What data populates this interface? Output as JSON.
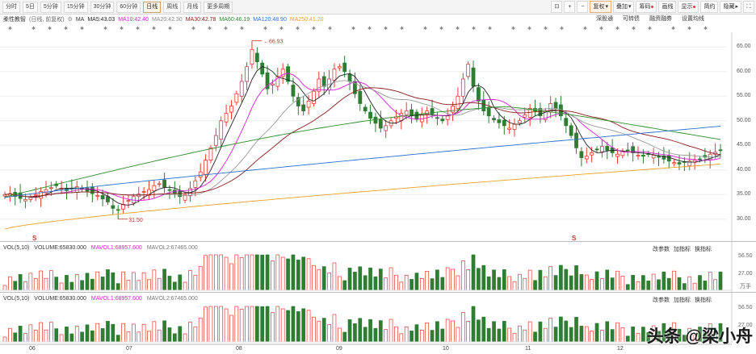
{
  "toolbar": {
    "periods": [
      "分时",
      "5日",
      "5分钟",
      "15分钟",
      "30分钟",
      "60分钟",
      "日线",
      "周线",
      "月线",
      "更多周期"
    ],
    "active_period": "日线",
    "right_buttons": [
      {
        "label": "复权",
        "icon": "chevron-down"
      },
      {
        "label": "叠加",
        "icon": "chevron-down"
      },
      {
        "label": "筹码",
        "badge": true
      },
      {
        "label": "画线"
      },
      {
        "label": "显示",
        "badge": true
      },
      {
        "label": "简约"
      },
      {
        "label": "隐藏",
        "icon": "chevron-right"
      }
    ],
    "small_icons": [
      "⊡",
      "+",
      "−"
    ]
  },
  "ma_line": {
    "title": "柔性教智",
    "sub": "(日线, 前复权)",
    "ma_label": "MA",
    "ma5": "MA5:43.03",
    "ma10": "MA10:42.40",
    "ma20": "MA20:42.30",
    "ma30": "MA30:42.78",
    "ma60": "MA60:46.19",
    "ma120": "MA120:48.90",
    "ma250": "MA250:41.20",
    "right_links": [
      "深股通",
      "可转债",
      "融资融券",
      "设置均线"
    ]
  },
  "price_axis": [
    "65.00",
    "60.00",
    "55.00",
    "50.00",
    "45.00",
    "40.00",
    "35.00",
    "30.00"
  ],
  "annotations": {
    "high": "66.93",
    "low": "31.50",
    "s_mark": "S"
  },
  "vol1": {
    "label": "VOL(5,10)",
    "volume": "VOLUME:65830.000",
    "mavol1": "MAVOL1:68957.600",
    "mavol2": "MAVOL2:67465.000",
    "axis": [
      "56.50",
      "27.00",
      "万手"
    ],
    "links": [
      "改参数",
      "加指标",
      "换指标"
    ]
  },
  "vol2": {
    "label": "VOL(5,10)",
    "volume": "VOLUME:65830.000",
    "mavol1": "MAVOL1:68957.600",
    "mavol2": "MAVOL2:67465.000",
    "axis": [
      "56.50",
      "27.00"
    ],
    "links": [
      "改参数",
      "加指标",
      "换指标"
    ]
  },
  "x_axis": [
    "06",
    "07",
    "08",
    "09",
    "10",
    "11",
    "12"
  ],
  "watermark": "头条 @梁小舟",
  "colors": {
    "up": "#e53935",
    "down": "#2e7d32",
    "ma5": "#222222",
    "ma10": "#d81bd8",
    "ma20": "#999999",
    "ma30": "#8b1a1a",
    "ma60": "#2e8b2e",
    "ma120": "#2a6fd0",
    "ma250": "#f0a020"
  },
  "chart_data": {
    "type": "candlestick",
    "x_axis_months": [
      "06",
      "07",
      "08",
      "09",
      "10",
      "11",
      "12"
    ],
    "y_range": [
      27.5,
      68
    ],
    "close": [
      35,
      35.2,
      34.6,
      34.2,
      34.0,
      34.4,
      35.0,
      35.6,
      36.0,
      36.4,
      36.8,
      36.3,
      35.8,
      36.2,
      36.6,
      36.1,
      35.7,
      35.2,
      34.8,
      34.1,
      33.5,
      32.2,
      31.8,
      33.0,
      33.8,
      34.6,
      35.1,
      35.6,
      36.0,
      36.8,
      37.2,
      36.5,
      35.9,
      35.2,
      34.6,
      35.0,
      36.2,
      37.8,
      39.6,
      42.0,
      44.5,
      47.0,
      50.0,
      51.5,
      53.0,
      55.5,
      58.0,
      61.0,
      64.5,
      62.0,
      59.5,
      56.5,
      57.5,
      59.0,
      60.5,
      58.0,
      55.0,
      53.0,
      52.0,
      54.0,
      56.0,
      58.5,
      57.0,
      58.5,
      60.5,
      61.0,
      60.0,
      58.0,
      55.5,
      53.5,
      52.0,
      50.5,
      49.5,
      48.5,
      49.0,
      50.0,
      50.8,
      51.5,
      52.0,
      51.0,
      50.3,
      51.2,
      52.0,
      51.4,
      50.6,
      50.0,
      51.0,
      53.0,
      55.0,
      58.5,
      61.5,
      57.0,
      54.0,
      52.0,
      51.0,
      50.2,
      49.6,
      49.0,
      48.5,
      49.3,
      50.0,
      51.2,
      52.5,
      52.0,
      51.0,
      52.0,
      53.5,
      52.5,
      51.0,
      49.0,
      47.0,
      44.5,
      42.5,
      42.8,
      43.5,
      44.2,
      44.8,
      44.0,
      43.5,
      43.2,
      43.8,
      44.0,
      43.5,
      43.0,
      42.8,
      43.2,
      43.0,
      42.6,
      42.2,
      41.8,
      41.5,
      41.2,
      41.6,
      41.8,
      42.0,
      42.2,
      42.6,
      43.2,
      43.6,
      44.0
    ],
    "ma60_end": 46.19,
    "ma120_end": 48.9,
    "ma250_end": 41.2
  }
}
